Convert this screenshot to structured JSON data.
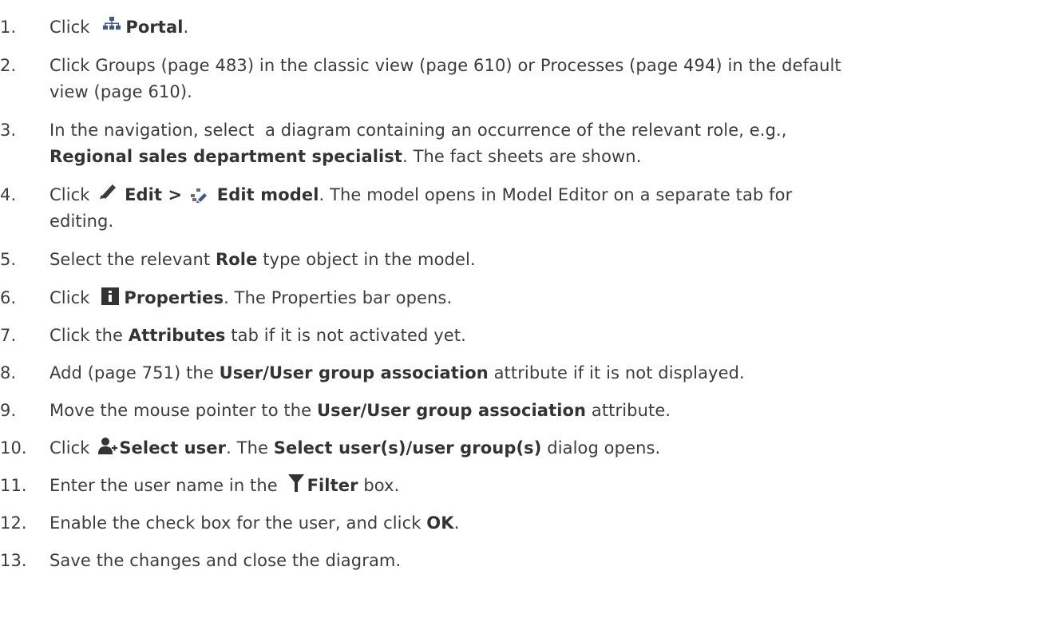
{
  "steps": [
    {
      "num": "1.",
      "pre": "Click",
      "label": "Portal",
      "post": ".",
      "icon": "portal-hierarchy-icon"
    },
    {
      "num": "2.",
      "line1": "Click Groups (page 483) in the classic view (page 610) or Processes (page 494) in the default",
      "line2": "view (page 610)."
    },
    {
      "num": "3.",
      "line1": "In the navigation, select  a diagram containing an occurrence of the relevant role, e.g.,",
      "line2_bold": "Regional sales department specialist",
      "line2_rest": ". The fact sheets are shown."
    },
    {
      "num": "4.",
      "pre": "Click",
      "edit_label": "Edit >",
      "edit_model_label": "Edit model",
      "post": ". The model opens in Model Editor on a separate tab for",
      "line2": "editing.",
      "icon_edit": "pencil-icon",
      "icon_model": "edit-model-icon"
    },
    {
      "num": "5.",
      "pre": "Select the relevant",
      "bold": "Role",
      "post": "type object in the model."
    },
    {
      "num": "6.",
      "pre": "Click",
      "label": "Properties",
      "post": ". The Properties bar opens.",
      "icon": "info-icon"
    },
    {
      "num": "7.",
      "pre": "Click the",
      "bold": "Attributes",
      "post": "tab if it is not activated yet."
    },
    {
      "num": "8.",
      "pre": "Add (page 751) the",
      "bold": "User/User group association",
      "post": "attribute if it is not displayed."
    },
    {
      "num": "9.",
      "pre": "Move the mouse pointer to the",
      "bold": "User/User group association",
      "post": "attribute."
    },
    {
      "num": "10.",
      "pre": "Click",
      "label": "Select user",
      "mid": ". The",
      "bold2": "Select user(s)/user group(s)",
      "post": "dialog opens.",
      "icon": "add-user-icon"
    },
    {
      "num": "11.",
      "pre": "Enter the user name in the",
      "label": "Filter",
      "post": "box.",
      "icon": "filter-icon"
    },
    {
      "num": "12.",
      "pre": "Enable the check box for the user, and click",
      "bold": "OK",
      "post": "."
    },
    {
      "num": "13.",
      "text": "Save the changes and close the diagram."
    }
  ]
}
